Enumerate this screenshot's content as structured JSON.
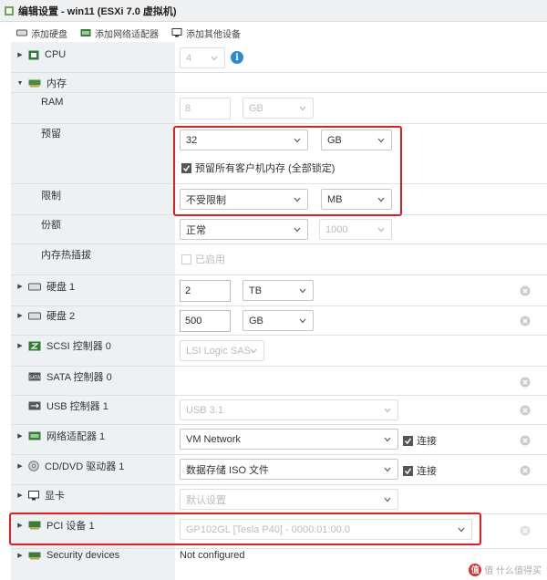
{
  "title": "编辑设置 - win11 (ESXi 7.0 虚拟机)",
  "toolbar": {
    "add_disk": "添加硬盘",
    "add_nic": "添加网络适配器",
    "add_other": "添加其他设备"
  },
  "cpu": {
    "label": "CPU",
    "value": "4"
  },
  "memory": {
    "label": "内存",
    "ram": {
      "label": "RAM",
      "value": "8",
      "unit": "GB"
    },
    "reserve": {
      "label": "预留",
      "value": "32",
      "unit": "GB",
      "lock_label": "预留所有客户机内存 (全部锁定)"
    },
    "limit": {
      "label": "限制",
      "value": "不受限制",
      "unit": "MB"
    },
    "shares": {
      "label": "份额",
      "value": "正常",
      "amount": "1000"
    },
    "hotplug": {
      "label": "内存热插拔",
      "checkbox_label": "已启用"
    }
  },
  "disk1": {
    "label": "硬盘 1",
    "value": "2",
    "unit": "TB"
  },
  "disk2": {
    "label": "硬盘 2",
    "value": "500",
    "unit": "GB"
  },
  "scsi": {
    "label": "SCSI 控制器 0",
    "value": "LSI Logic SAS"
  },
  "sata": {
    "label": "SATA 控制器 0"
  },
  "usb": {
    "label": "USB 控制器 1",
    "value": "USB 3.1"
  },
  "nic": {
    "label": "网络适配器 1",
    "value": "VM Network",
    "connect_label": "连接"
  },
  "cdrom": {
    "label": "CD/DVD 驱动器 1",
    "value": "数据存储 ISO 文件",
    "connect_label": "连接"
  },
  "gpu": {
    "label": "显卡",
    "value": "默认设置"
  },
  "pci": {
    "label": "PCI 设备 1",
    "value": "GP102GL [Tesla P40] - 0000:01:00.0"
  },
  "security": {
    "label": "Security devices",
    "value": "Not configured"
  },
  "watermark": "值 什么值得买",
  "colors": {
    "highlight": "#e02020",
    "label_bg": "#eef1f4",
    "info": "#2a8ad6"
  }
}
